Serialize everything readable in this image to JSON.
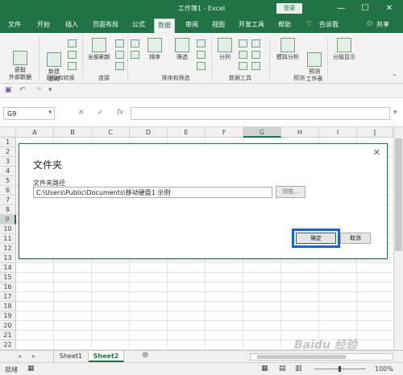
{
  "window": {
    "title": "工作簿1 - Excel",
    "login": "登录",
    "minimize": "—",
    "restore": "☐",
    "close": "✕"
  },
  "tabs": [
    "文件",
    "开始",
    "插入",
    "页面布局",
    "公式",
    "数据",
    "审阅",
    "视图",
    "开发工具",
    "帮助"
  ],
  "active_tab": "数据",
  "tellme": "告诉我",
  "share": "共享",
  "ribbon": {
    "get_external": "获取\n外部数据",
    "new_query": "新建\n查询",
    "refresh_all": "全部刷新",
    "sort": "排序",
    "filter": "筛选",
    "split": "分列",
    "whatif": "模拟分析",
    "forecast": "预测\n工作表",
    "outline": "分级显示",
    "groups": [
      "获取和转换",
      "连接",
      "排序和筛选",
      "数据工具",
      "预测"
    ]
  },
  "namebox": "G9",
  "fx": "fx",
  "columns": [
    "A",
    "B",
    "C",
    "D",
    "E",
    "F",
    "G",
    "H",
    "I",
    "J"
  ],
  "selected_column": "G",
  "rows": [
    "1",
    "2",
    "3",
    "4",
    "5",
    "6",
    "7",
    "8",
    "9",
    "10",
    "11",
    "12",
    "13",
    "14",
    "15",
    "16",
    "17",
    "18",
    "19",
    "20",
    "21",
    "22"
  ],
  "selected_row": "9",
  "dialog": {
    "title": "文件夹",
    "label": "文件夹路径",
    "path": "C:\\Users\\Public\\Documents\\移动硬盘1 示例",
    "browse": "浏览...",
    "ok": "确定",
    "cancel": "取消"
  },
  "sheets": [
    "Sheet1",
    "Sheet2"
  ],
  "active_sheet": "Sheet2",
  "status": {
    "ready": "就绪",
    "zoom": "100%"
  },
  "watermark": "Baidu 经验"
}
